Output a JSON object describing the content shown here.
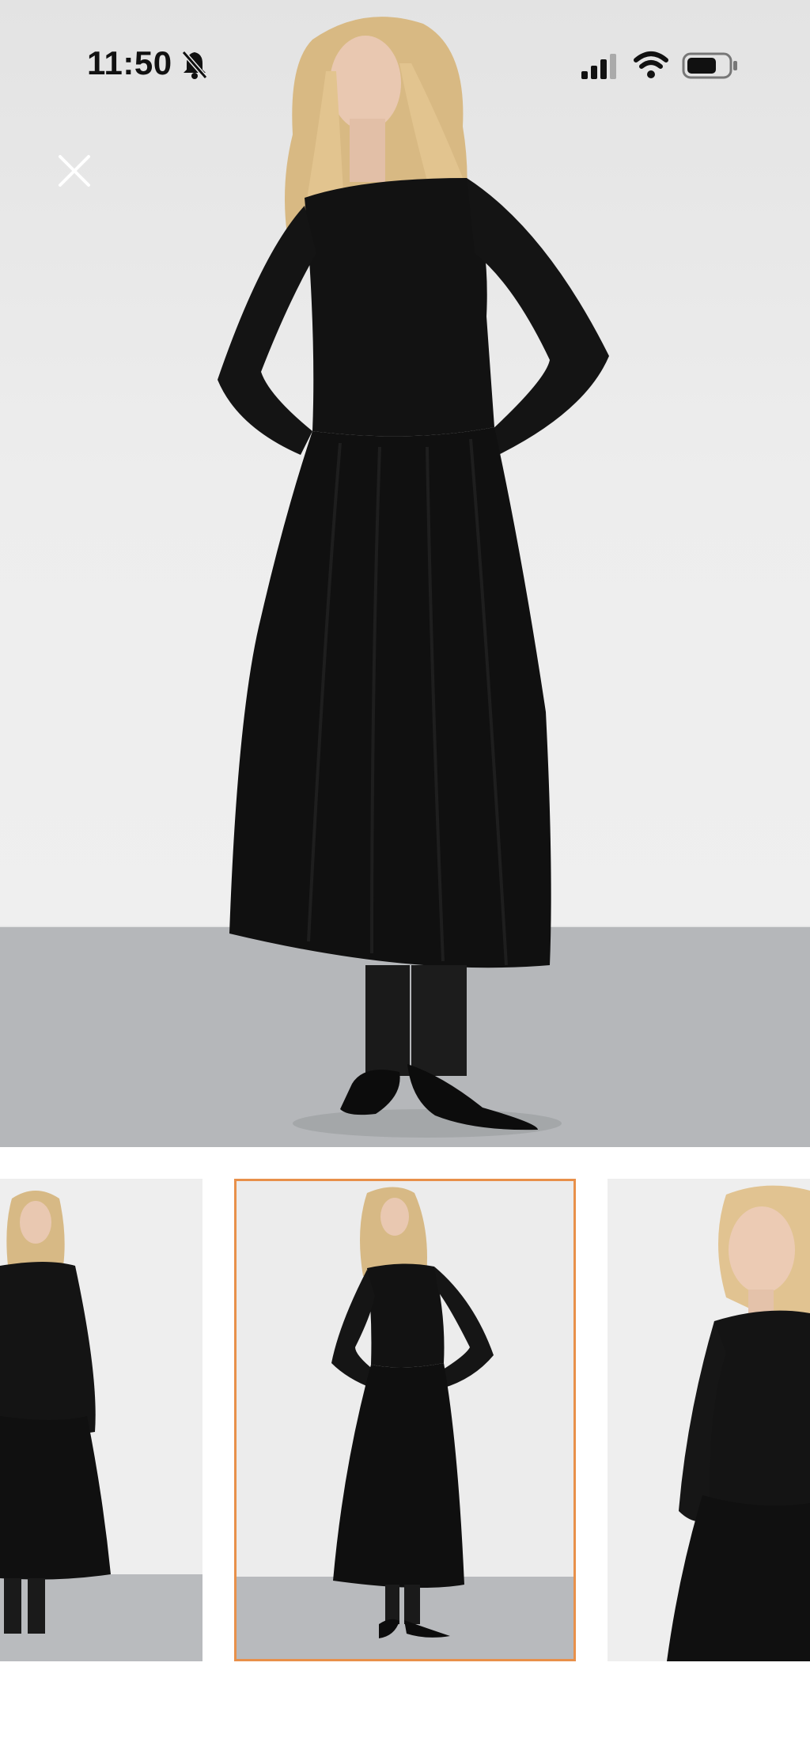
{
  "status_bar": {
    "time": "11:50",
    "icons": [
      "bell-slash-icon",
      "cellular-signal-icon",
      "wifi-icon",
      "battery-icon"
    ]
  },
  "viewer": {
    "close_icon": "close-icon",
    "main_image": "product-photo-black-midi-dress",
    "thumbnails": [
      {
        "name": "thumbnail-1",
        "selected": false
      },
      {
        "name": "thumbnail-2",
        "selected": true
      },
      {
        "name": "thumbnail-3",
        "selected": false
      }
    ]
  },
  "colors": {
    "selected_border": "#e8904a",
    "dress": "#111111",
    "wall": "#ededed",
    "floor": "#b3b5b8"
  }
}
